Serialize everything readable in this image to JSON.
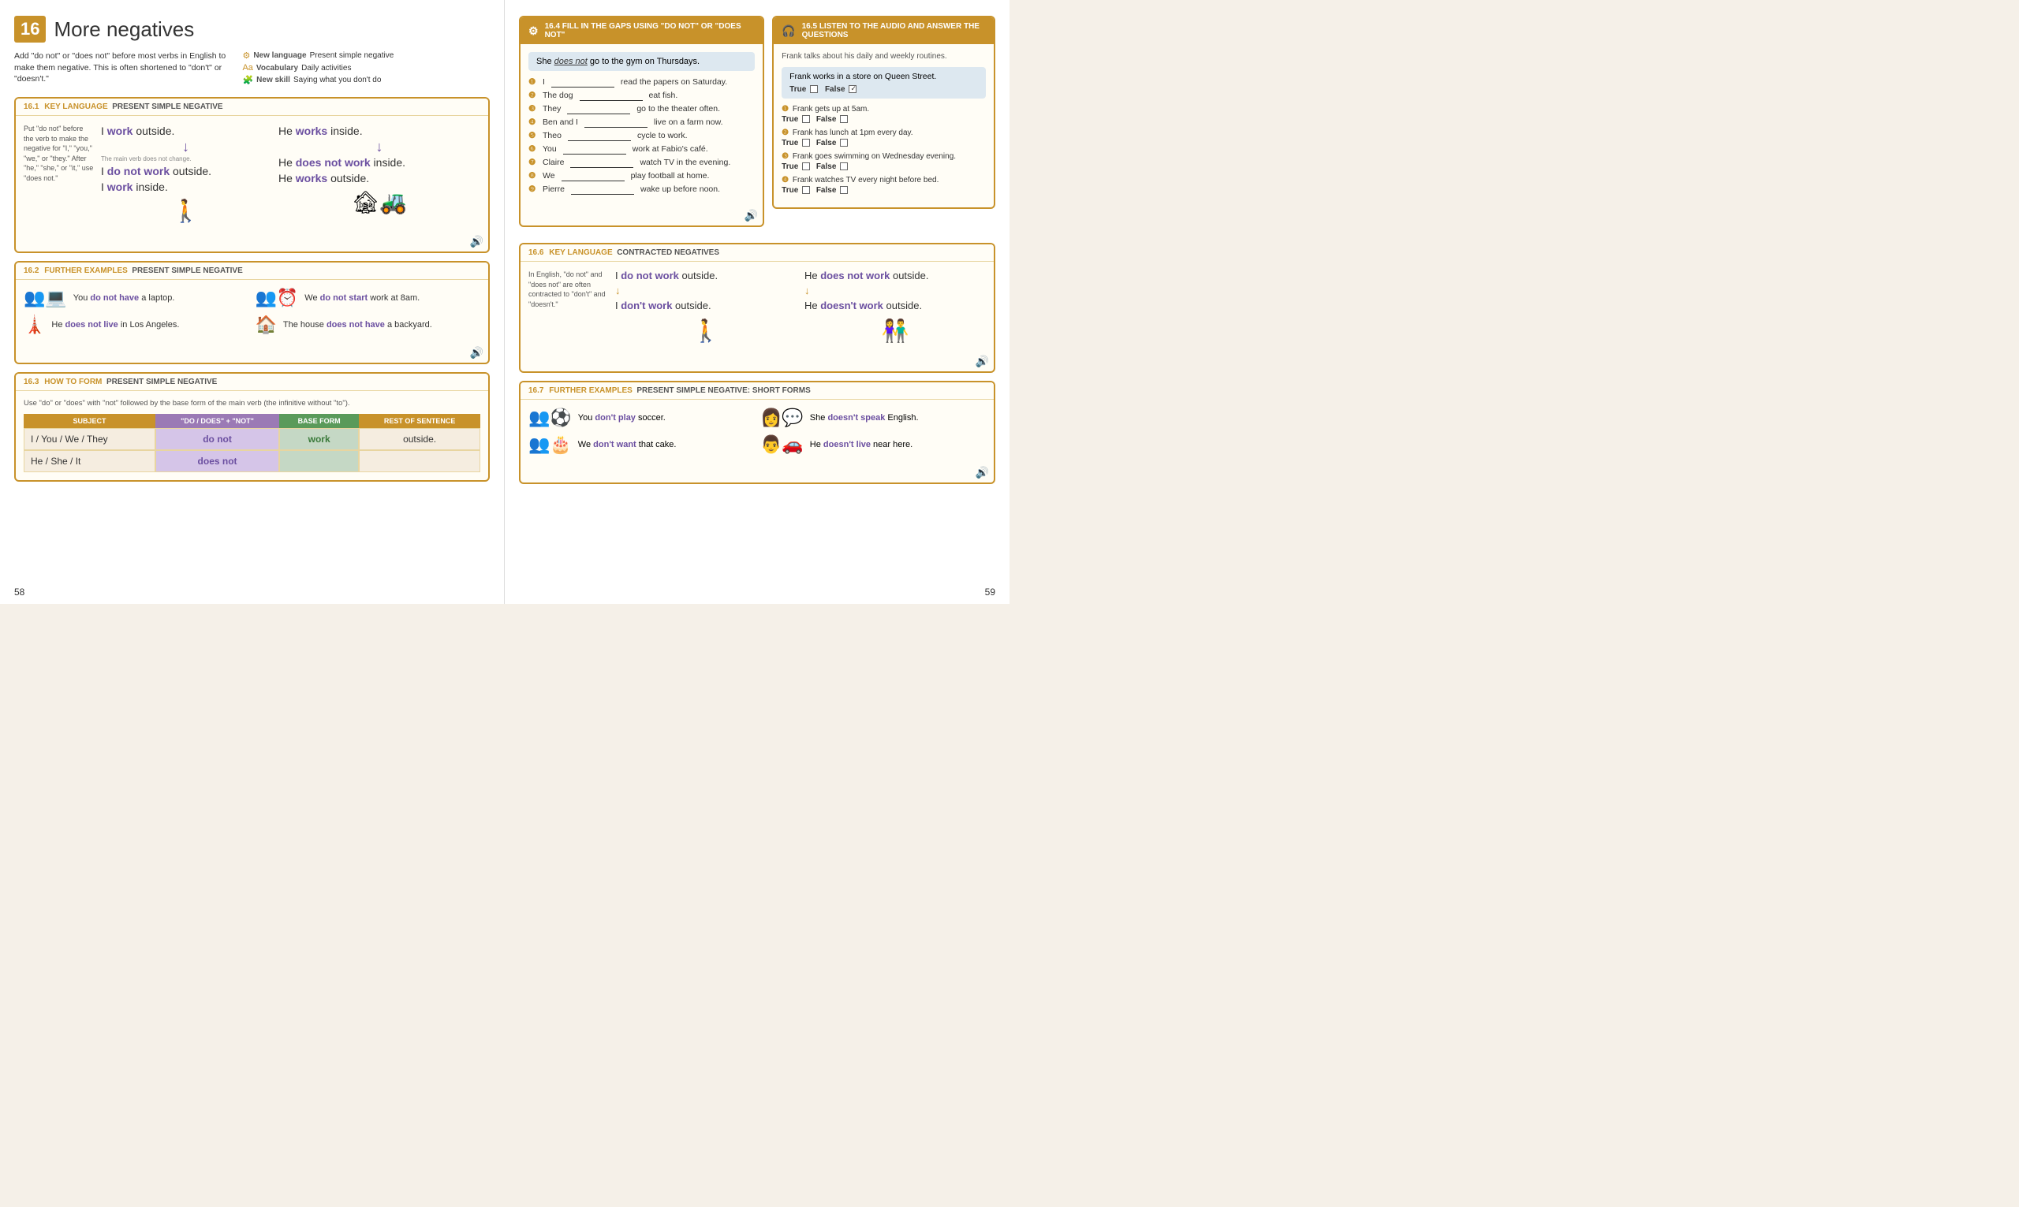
{
  "left_page": {
    "page_number": "58",
    "chapter_number": "16",
    "chapter_title": "More negatives",
    "intro_text": "Add \"do not\" or \"does not\" before most verbs in English to make them negative. This is often shortened to \"don't\" or \"doesn't.\"",
    "tags": [
      {
        "icon": "⚙",
        "label": "New language",
        "value": "Present simple negative"
      },
      {
        "icon": "Aa",
        "label": "Vocabulary",
        "value": "Daily activities"
      },
      {
        "icon": "🧩",
        "label": "New skill",
        "value": "Saying what you don't do"
      }
    ],
    "section_161": {
      "id": "16.1",
      "type": "KEY LANGUAGE",
      "topic": "PRESENT SIMPLE NEGATIVE",
      "explanation": "Put \"do not\" before the verb to make the negative for \"I,\" \"you,\" \"we,\" or \"they.\" After \"he,\" \"she,\" or \"it,\" use \"does not.\"",
      "note": "The main verb does not change.",
      "examples_left": [
        "I work outside.",
        "I do not work outside.",
        "I work inside."
      ],
      "examples_right": [
        "He works inside.",
        "He does not work inside.",
        "He works outside."
      ]
    },
    "section_162": {
      "id": "16.2",
      "type": "FURTHER EXAMPLES",
      "topic": "PRESENT SIMPLE NEGATIVE",
      "examples": [
        {
          "icon": "👥🪑💻",
          "text": "You do not have a laptop."
        },
        {
          "icon": "👥⏰",
          "text": "We do not start work at 8am."
        },
        {
          "icon": "🗼",
          "text": "He does not live in Los Angeles."
        },
        {
          "icon": "🏠",
          "text": "The house does not have a backyard."
        }
      ]
    },
    "section_163": {
      "id": "16.3",
      "type": "HOW TO FORM",
      "topic": "PRESENT SIMPLE NEGATIVE",
      "description": "Use \"do\" or \"does\" with \"not\" followed by the base form of the main verb (the infinitive without \"to\").",
      "table_headers": [
        "SUBJECT",
        "\"DO / DOES\" + \"NOT\"",
        "BASE FORM",
        "REST OF SENTENCE"
      ],
      "table_rows": [
        [
          "I / You / We / They",
          "do not",
          "work",
          "outside."
        ],
        [
          "He / She / It",
          "does not",
          "",
          ""
        ]
      ]
    }
  },
  "right_page": {
    "page_number": "59",
    "section_164": {
      "id": "16.4",
      "type": "FILL IN THE GAPS USING \"DO NOT\" OR \"DOES NOT\"",
      "example_sentence": "She does not go to the gym on Thursdays.",
      "questions": [
        {
          "num": "1",
          "text": "I ___________ read the papers on Saturday."
        },
        {
          "num": "2",
          "text": "The dog ___________ eat fish."
        },
        {
          "num": "3",
          "text": "They ___________ go to the theater often."
        },
        {
          "num": "4",
          "text": "Ben and I ___________ live on a farm now."
        },
        {
          "num": "5",
          "text": "Theo ___________ cycle to work."
        },
        {
          "num": "6",
          "text": "You ___________ work at Fabio's café."
        },
        {
          "num": "7",
          "text": "Claire ___________ watch TV in the evening."
        },
        {
          "num": "8",
          "text": "We ___________ play football at home."
        },
        {
          "num": "9",
          "text": "Pierre ___________ wake up before noon."
        }
      ]
    },
    "section_165": {
      "id": "16.5",
      "type": "LISTEN TO THE AUDIO AND ANSWER THE QUESTIONS",
      "intro": "Frank talks about his daily and weekly routines.",
      "statement": "Frank works in a store on Queen Street.",
      "statement_tf": {
        "true": false,
        "false": true
      },
      "questions": [
        {
          "num": "1",
          "text": "Frank gets up at 5am.",
          "true": false,
          "false": false
        },
        {
          "num": "2",
          "text": "Frank has lunch at 1pm every day.",
          "true": false,
          "false": false
        },
        {
          "num": "3",
          "text": "Frank goes swimming on Wednesday evening.",
          "true": false,
          "false": false
        },
        {
          "num": "4",
          "text": "Frank watches TV every night before bed.",
          "true": false,
          "false": false
        }
      ]
    },
    "section_166": {
      "id": "16.6",
      "type": "KEY LANGUAGE",
      "topic": "CONTRACTED NEGATIVES",
      "explanation": "In English, \"do not\" and \"does not\" are often contracted to \"don't\" and \"doesn't.\"",
      "examples": [
        {
          "original": "I do not work outside.",
          "contracted": "I don't work outside."
        },
        {
          "original": "He does not work outside.",
          "contracted": "He doesn't work outside."
        }
      ]
    },
    "section_167": {
      "id": "16.7",
      "type": "FURTHER EXAMPLES",
      "topic": "PRESENT SIMPLE NEGATIVE: SHORT FORMS",
      "examples": [
        {
          "icon": "👥⚽",
          "text": "You don't play soccer."
        },
        {
          "icon": "👩💬",
          "text": "She doesn't speak English."
        },
        {
          "icon": "👥🎂",
          "text": "We don't want that cake."
        },
        {
          "icon": "👨🚗",
          "text": "He doesn't live near here."
        }
      ]
    }
  }
}
